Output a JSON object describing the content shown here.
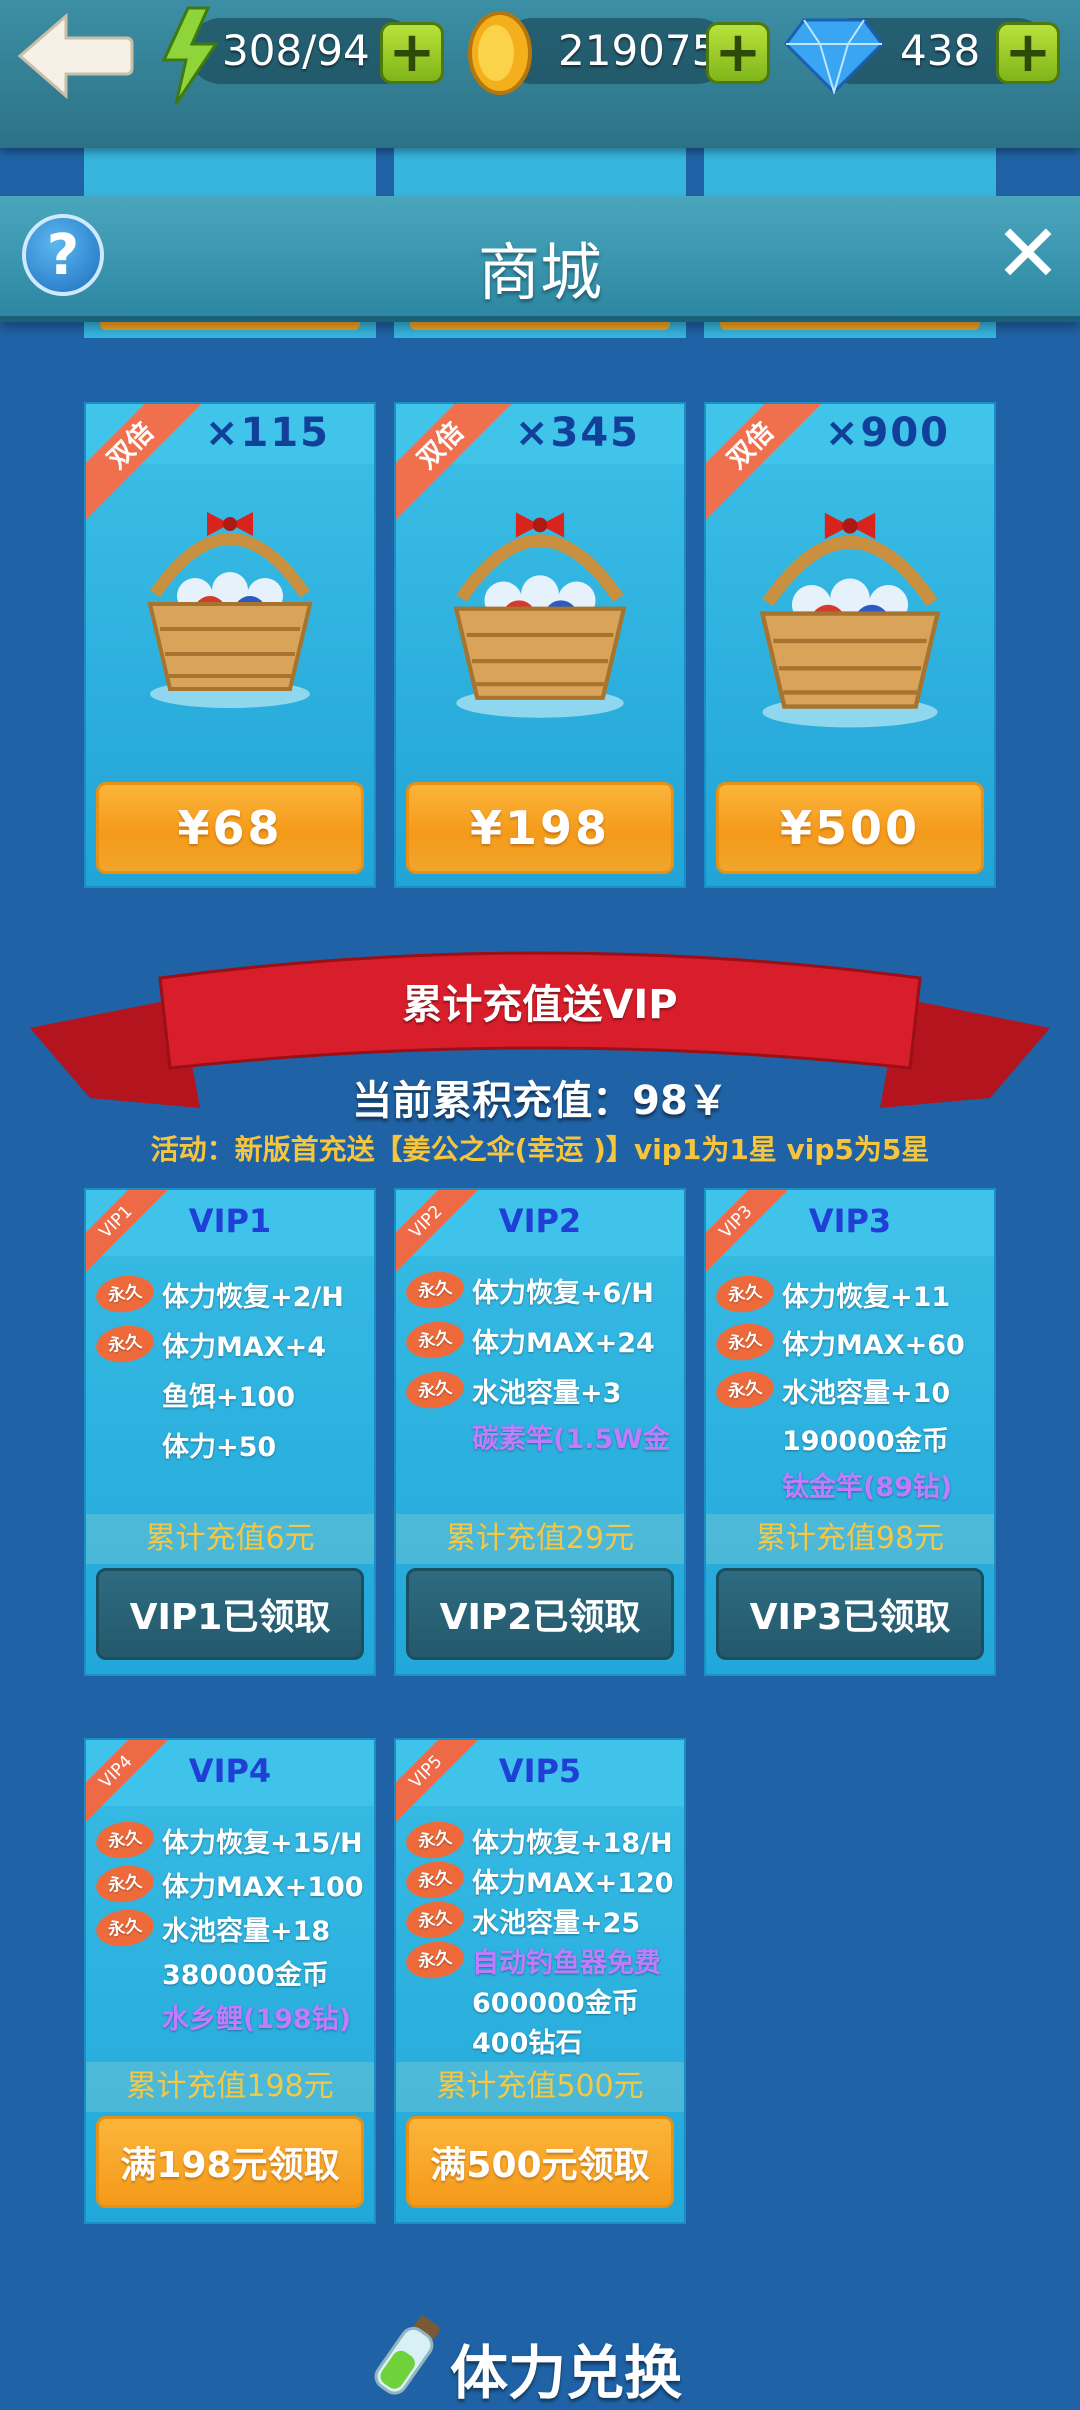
{
  "topbar": {
    "energy": "308/94",
    "coins": "219075",
    "diamonds": "438",
    "plus_label": "+"
  },
  "header": {
    "title": "商城",
    "help_label": "?",
    "close_label": "✕"
  },
  "gem_packs": [
    {
      "badge": "双倍",
      "quantity": "×115",
      "price": "¥68"
    },
    {
      "badge": "双倍",
      "quantity": "×345",
      "price": "¥198"
    },
    {
      "badge": "双倍",
      "quantity": "×900",
      "price": "¥500"
    }
  ],
  "vip_banner": {
    "title": "累计充值送VIP",
    "current": "当前累积充值：98￥",
    "activity": "活动：新版首充送【姜公之伞(幸运 )】vip1为1星 vip5为5星"
  },
  "vip_cards": [
    {
      "corner": "VIP1",
      "name": "VIP1",
      "benefits": [
        "体力恢复+2/H",
        "体力MAX+4",
        "鱼饵+100",
        "体力+50"
      ],
      "total": "累计充值6元",
      "button": "VIP1已领取"
    },
    {
      "corner": "VIP2",
      "name": "VIP2",
      "benefits": [
        "体力恢复+6/H",
        "体力MAX+24",
        "水池容量+3",
        "碳素竿(1.5W金"
      ],
      "total": "累计充值29元",
      "button": "VIP2已领取"
    },
    {
      "corner": "VIP3",
      "name": "VIP3",
      "benefits": [
        "体力恢复+11",
        "体力MAX+60",
        "水池容量+10",
        "190000金币",
        "钛金竿(89钻)"
      ],
      "total": "累计充值98元",
      "button": "VIP3已领取"
    },
    {
      "corner": "VIP4",
      "name": "VIP4",
      "benefits": [
        "体力恢复+15/H",
        "体力MAX+100",
        "水池容量+18",
        "380000金币",
        "水乡鲤(198钻)"
      ],
      "total": "累计充值198元",
      "button": "满198元领取"
    },
    {
      "corner": "VIP5",
      "name": "VIP5",
      "benefits": [
        "体力恢复+18/H",
        "体力MAX+120",
        "水池容量+25",
        "自动钓鱼器免费",
        "600000金币",
        "400钻石"
      ],
      "total": "累计充值500元",
      "button": "满500元领取"
    }
  ],
  "perm_badge": "永久",
  "exchange": {
    "title": "体力兑换"
  },
  "colors": {
    "background": "#1f63a6",
    "card": "#2bb0e0",
    "price_button": "#f59a1a",
    "claimed_button": "#2a6476",
    "perm_badge": "#ee6a3a",
    "vip_name": "#1f3fd6",
    "highlight_purple": "#c07bff",
    "activity_text": "#f7c53d"
  }
}
